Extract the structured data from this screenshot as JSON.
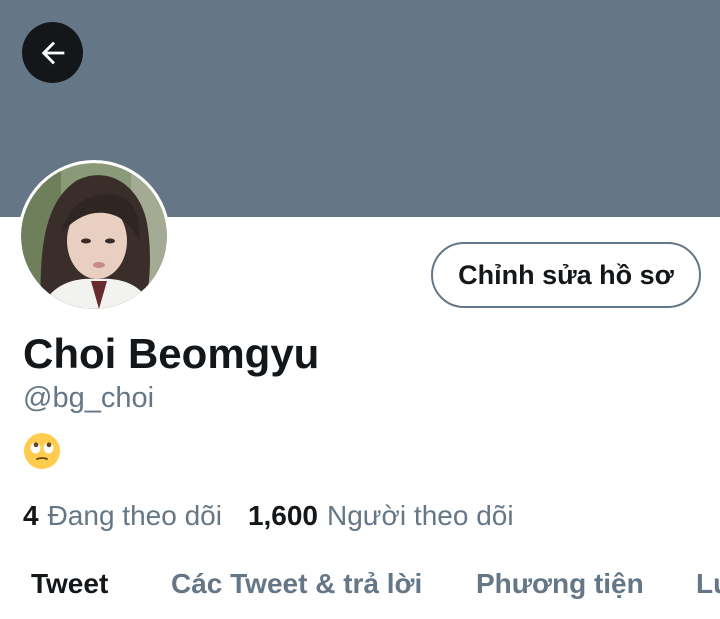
{
  "header": {
    "back_icon": "arrow-left-icon",
    "banner_color": "#657786"
  },
  "profile": {
    "display_name": "Choi Beomgyu",
    "handle": "@bg_choi",
    "bio_emoji_icon": "face-with-rolling-eyes-icon",
    "edit_button_label": "Chỉnh sửa hồ sơ"
  },
  "stats": {
    "following_count": "4",
    "following_label": "Đang theo dõi",
    "followers_count": "1,600",
    "followers_label": "Người theo dõi"
  },
  "tabs": [
    {
      "label": "Tweet",
      "active": true
    },
    {
      "label": "Các Tweet & trả lời",
      "active": false
    },
    {
      "label": "Phương tiện",
      "active": false
    },
    {
      "label": "Lu",
      "active": false
    }
  ],
  "colors": {
    "primary_text": "#14171a",
    "secondary_text": "#657786"
  }
}
